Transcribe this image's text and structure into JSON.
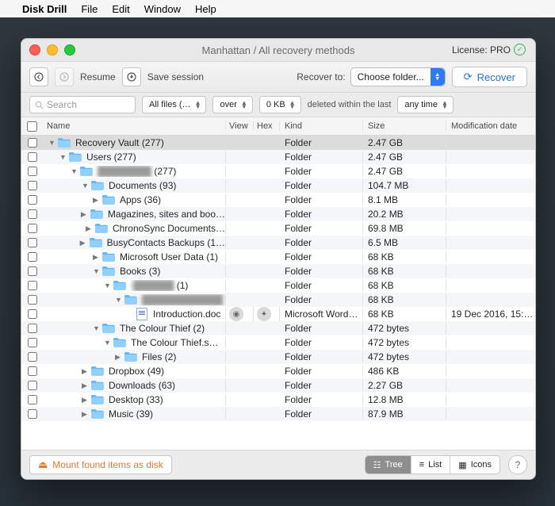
{
  "menubar": {
    "app": "Disk Drill",
    "items": [
      "File",
      "Edit",
      "Window",
      "Help"
    ]
  },
  "window": {
    "title": "Manhattan / All recovery methods",
    "license_label": "License: PRO"
  },
  "toolbar": {
    "resume": "Resume",
    "save_session": "Save session",
    "recover_to": "Recover to:",
    "choose_folder": "Choose folder...",
    "recover": "Recover"
  },
  "filters": {
    "search_placeholder": "Search",
    "all_files": "All files (…",
    "over": "over",
    "size": "0 KB",
    "deleted_label": "deleted within the last",
    "any_time": "any time"
  },
  "columns": {
    "name": "Name",
    "view": "View",
    "hex": "Hex",
    "kind": "Kind",
    "size": "Size",
    "mod": "Modification date"
  },
  "rows": [
    {
      "indent": 0,
      "disc": "down",
      "icon": "folder",
      "name": "Recovery Vault (277)",
      "kind": "Folder",
      "size": "2.47 GB",
      "mod": "",
      "sel": true
    },
    {
      "indent": 1,
      "disc": "down",
      "icon": "folder",
      "name": "Users (277)",
      "kind": "Folder",
      "size": "2.47 GB",
      "mod": ""
    },
    {
      "indent": 2,
      "disc": "down",
      "icon": "folder",
      "name": "████████",
      "suffix": " (277)",
      "blur": true,
      "kind": "Folder",
      "size": "2.47 GB",
      "mod": ""
    },
    {
      "indent": 3,
      "disc": "down",
      "icon": "folder",
      "name": "Documents (93)",
      "kind": "Folder",
      "size": "104.7 MB",
      "mod": ""
    },
    {
      "indent": 4,
      "disc": "right",
      "icon": "folder",
      "name": "Apps (36)",
      "kind": "Folder",
      "size": "8.1 MB",
      "mod": ""
    },
    {
      "indent": 4,
      "disc": "right",
      "icon": "folder",
      "name": "Magazines, sites and boo…",
      "kind": "Folder",
      "size": "20.2 MB",
      "mod": ""
    },
    {
      "indent": 4,
      "disc": "right",
      "icon": "folder",
      "name": "ChronoSync Documents…",
      "kind": "Folder",
      "size": "69.8 MB",
      "mod": ""
    },
    {
      "indent": 4,
      "disc": "right",
      "icon": "folder",
      "name": "BusyContacts Backups (1…",
      "kind": "Folder",
      "size": "6.5 MB",
      "mod": ""
    },
    {
      "indent": 4,
      "disc": "right",
      "icon": "folder",
      "name": "Microsoft User Data (1)",
      "kind": "Folder",
      "size": "68 KB",
      "mod": ""
    },
    {
      "indent": 4,
      "disc": "down",
      "icon": "folder",
      "name": "Books (3)",
      "kind": "Folder",
      "size": "68 KB",
      "mod": ""
    },
    {
      "indent": 5,
      "disc": "down",
      "icon": "folder",
      "name": "I██████",
      "suffix": " (1)",
      "blur": true,
      "kind": "Folder",
      "size": "68 KB",
      "mod": ""
    },
    {
      "indent": 6,
      "disc": "down",
      "icon": "folder",
      "name": "████████████",
      "blur": true,
      "kind": "Folder",
      "size": "68 KB",
      "mod": ""
    },
    {
      "indent": 7,
      "disc": "",
      "icon": "page",
      "name": "Introduction.doc",
      "kind": "Microsoft Word…",
      "size": "68 KB",
      "mod": "19 Dec 2016, 15:…",
      "actions": true
    },
    {
      "indent": 4,
      "disc": "down",
      "icon": "folder",
      "name": "The Colour Thief (2)",
      "kind": "Folder",
      "size": "472 bytes",
      "mod": ""
    },
    {
      "indent": 5,
      "disc": "down",
      "icon": "folder",
      "name": "The Colour Thief.s…",
      "kind": "Folder",
      "size": "472 bytes",
      "mod": ""
    },
    {
      "indent": 6,
      "disc": "right",
      "icon": "folder",
      "name": "Files (2)",
      "kind": "Folder",
      "size": "472 bytes",
      "mod": ""
    },
    {
      "indent": 3,
      "disc": "right",
      "icon": "folder",
      "name": "Dropbox (49)",
      "kind": "Folder",
      "size": "486 KB",
      "mod": ""
    },
    {
      "indent": 3,
      "disc": "right",
      "icon": "folder",
      "name": "Downloads (63)",
      "kind": "Folder",
      "size": "2.27 GB",
      "mod": ""
    },
    {
      "indent": 3,
      "disc": "right",
      "icon": "folder",
      "name": "Desktop (33)",
      "kind": "Folder",
      "size": "12.8 MB",
      "mod": ""
    },
    {
      "indent": 3,
      "disc": "right",
      "icon": "folder",
      "name": "Music (39)",
      "kind": "Folder",
      "size": "87.9 MB",
      "mod": ""
    }
  ],
  "footer": {
    "mount": "Mount found items as disk",
    "tree": "Tree",
    "list": "List",
    "icons": "Icons"
  }
}
